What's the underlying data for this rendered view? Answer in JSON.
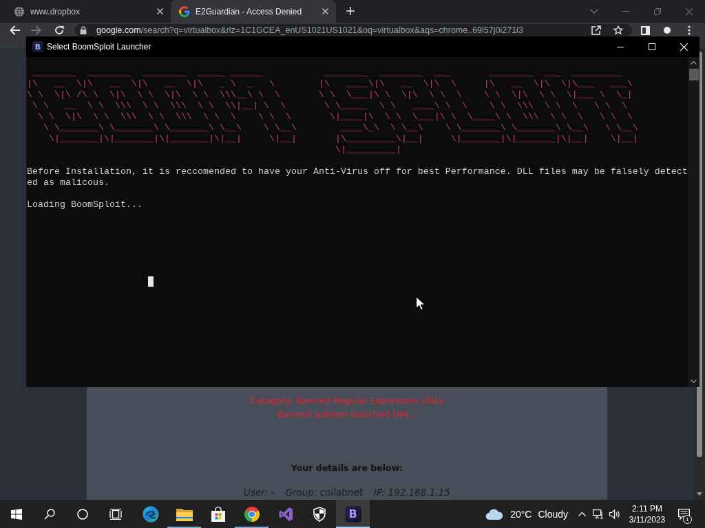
{
  "browser": {
    "tabs": [
      {
        "title": "www.dropbox",
        "selected": false
      },
      {
        "title": "E2Guardian - Access Denied",
        "selected": true
      }
    ],
    "address_bar": {
      "host": "google.com",
      "path": "/search?q=virtualbox&rlz=1C1GCEA_enUS1021US1021&oq=virtualbox&aqs=chrome..69i57j0i271l3"
    }
  },
  "page": {
    "category": "Category: Banned Regular Expression URLs",
    "pattern": "Banned pattern matched URL :",
    "details_heading": "Your details are below:",
    "details": [
      "User: -",
      "Group: collabnet",
      "IP: 192.168.1.15"
    ]
  },
  "console": {
    "logo": "B",
    "title": "Select BoomSploit Launcher",
    "banner": [
      " ________  ________  ________  _____ ______           ________  ________  ___       ________  ___  _________",
      "|\\   __  \\|\\   __  \\|\\   __  \\|\\   _ \\  _   \\        |\\   ____\\|\\   __  \\|\\  \\     |\\   __  \\|\\  \\|\\___   ___\\",
      "\\ \\  \\|\\ /\\ \\  \\|\\  \\ \\  \\|\\  \\ \\  \\\\\\__\\ \\  \\       \\ \\  \\___|\\ \\  \\|\\  \\ \\  \\    \\ \\  \\|\\  \\ \\  \\|___ \\  \\_|",
      " \\ \\   __  \\ \\  \\\\\\  \\ \\  \\\\\\  \\ \\  \\\\|__| \\  \\       \\ \\_____  \\ \\   ____\\ \\  \\    \\ \\  \\\\\\  \\ \\  \\   \\ \\  \\",
      "  \\ \\  \\|\\  \\ \\  \\\\\\  \\ \\  \\\\\\  \\ \\  \\    \\ \\  \\       \\|____|\\  \\ \\  \\___|\\ \\  \\____\\ \\  \\\\\\  \\ \\  \\   \\ \\  \\",
      "   \\ \\_______\\ \\_______\\ \\_______\\ \\__\\    \\ \\__\\        ____\\_\\  \\ \\__\\    \\ \\_______\\ \\_______\\ \\__\\   \\ \\__\\",
      "    \\|_______|\\|_______|\\|_______|\\|__|     \\|__|       |\\_________\\|__|     \\|_______|\\|_______|\\|__|    \\|__|",
      "                                                        \\|_________|"
    ],
    "notice": "Before Installation, it is reccomended to have your Anti-Virus off for best Performance. DLL files may be falsely detected as malicous.",
    "status": "Loading BoomSploit..."
  },
  "taskbar": {
    "apps": [
      {
        "running": false,
        "selected": false
      },
      {
        "running": true,
        "selected": false
      },
      {
        "running": false,
        "selected": false
      },
      {
        "running": true,
        "selected": false
      },
      {
        "running": false,
        "selected": false
      },
      {
        "running": false,
        "selected": false
      },
      {
        "logo": "B",
        "running": true,
        "selected": true
      }
    ],
    "weather": {
      "temperature": "20°C",
      "condition": "Cloudy"
    },
    "time": "2:11 PM",
    "date": "3/11/2023",
    "notifications": "1"
  }
}
